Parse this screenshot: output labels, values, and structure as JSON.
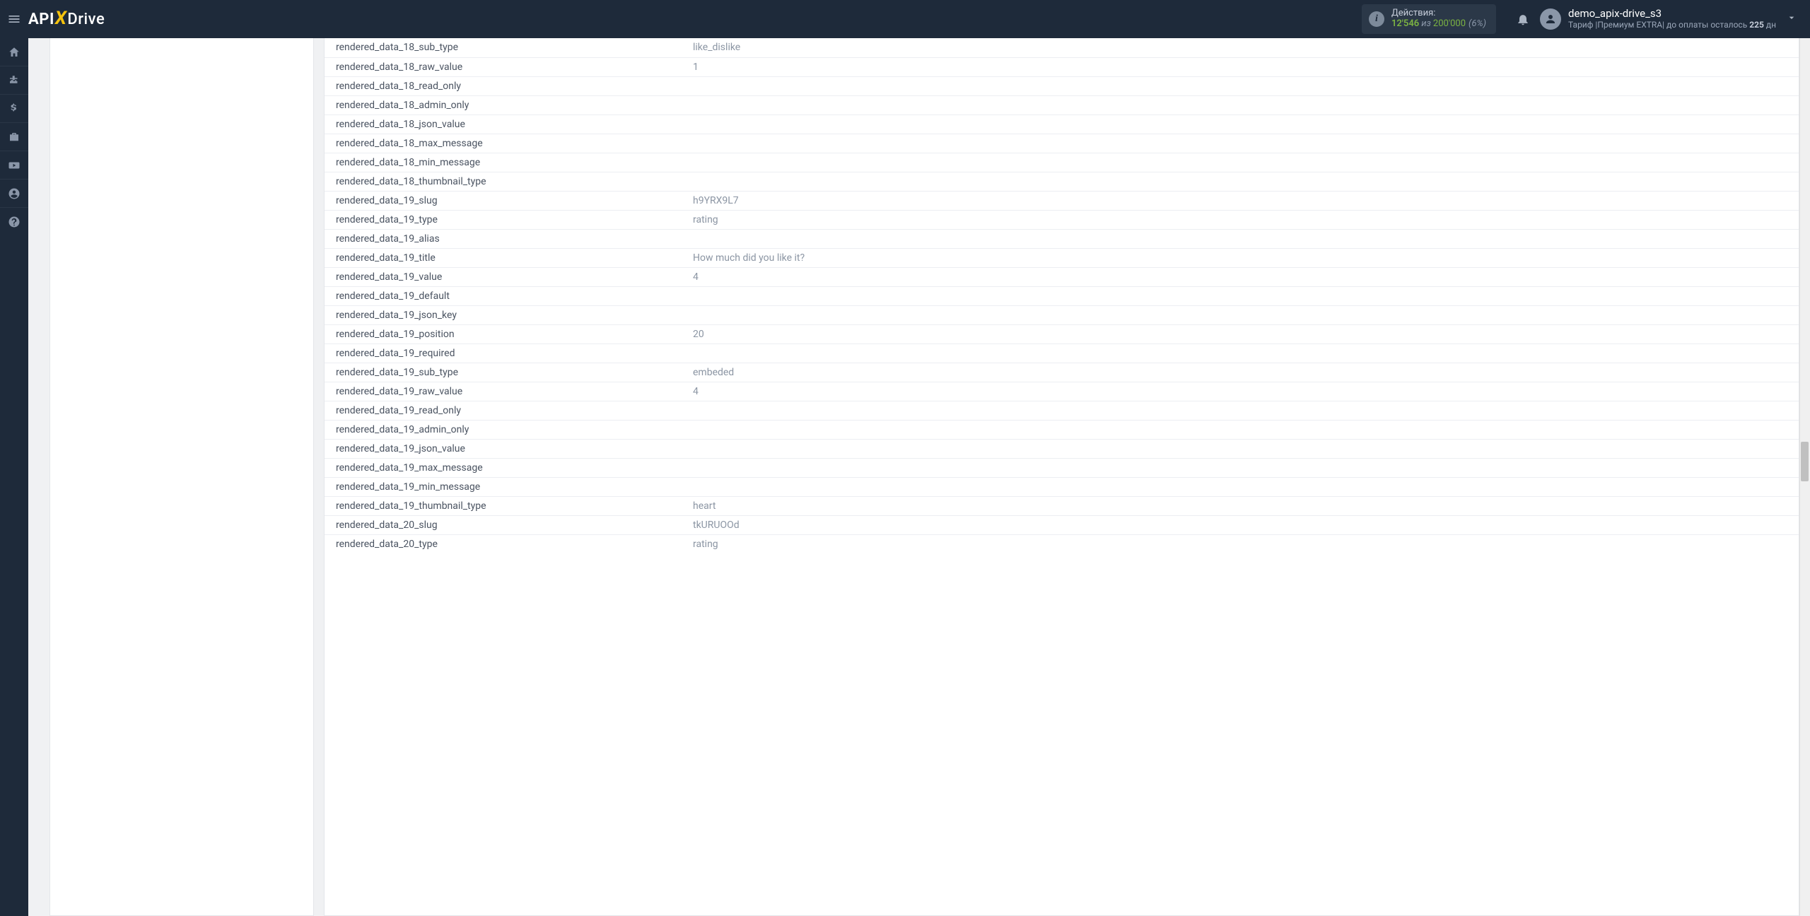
{
  "header": {
    "logo": {
      "api": "API",
      "x": "X",
      "drive": "Drive"
    },
    "actions": {
      "label": "Действия:",
      "used": "12'546",
      "iz": "из",
      "total": "200'000",
      "pct": "(6%)"
    },
    "user": {
      "name": "demo_apix-drive_s3",
      "tariff_label": "Тариф",
      "tariff_sep": " |",
      "tariff_name": "Премиум EXTRA",
      "tariff_sep2": "| ",
      "days_prefix": "до оплаты осталось ",
      "days": "225",
      "days_suffix": " дн"
    }
  },
  "rows": [
    {
      "key": "rendered_data_18_sub_type",
      "val": "like_dislike"
    },
    {
      "key": "rendered_data_18_raw_value",
      "val": "1"
    },
    {
      "key": "rendered_data_18_read_only",
      "val": ""
    },
    {
      "key": "rendered_data_18_admin_only",
      "val": ""
    },
    {
      "key": "rendered_data_18_json_value",
      "val": ""
    },
    {
      "key": "rendered_data_18_max_message",
      "val": ""
    },
    {
      "key": "rendered_data_18_min_message",
      "val": ""
    },
    {
      "key": "rendered_data_18_thumbnail_type",
      "val": ""
    },
    {
      "key": "rendered_data_19_slug",
      "val": "h9YRX9L7"
    },
    {
      "key": "rendered_data_19_type",
      "val": "rating"
    },
    {
      "key": "rendered_data_19_alias",
      "val": ""
    },
    {
      "key": "rendered_data_19_title",
      "val": "How much did you like it?"
    },
    {
      "key": "rendered_data_19_value",
      "val": "4"
    },
    {
      "key": "rendered_data_19_default",
      "val": ""
    },
    {
      "key": "rendered_data_19_json_key",
      "val": ""
    },
    {
      "key": "rendered_data_19_position",
      "val": "20"
    },
    {
      "key": "rendered_data_19_required",
      "val": ""
    },
    {
      "key": "rendered_data_19_sub_type",
      "val": "embeded"
    },
    {
      "key": "rendered_data_19_raw_value",
      "val": "4"
    },
    {
      "key": "rendered_data_19_read_only",
      "val": ""
    },
    {
      "key": "rendered_data_19_admin_only",
      "val": ""
    },
    {
      "key": "rendered_data_19_json_value",
      "val": ""
    },
    {
      "key": "rendered_data_19_max_message",
      "val": ""
    },
    {
      "key": "rendered_data_19_min_message",
      "val": ""
    },
    {
      "key": "rendered_data_19_thumbnail_type",
      "val": "heart"
    },
    {
      "key": "rendered_data_20_slug",
      "val": "tkURUOOd"
    },
    {
      "key": "rendered_data_20_type",
      "val": "rating"
    }
  ]
}
